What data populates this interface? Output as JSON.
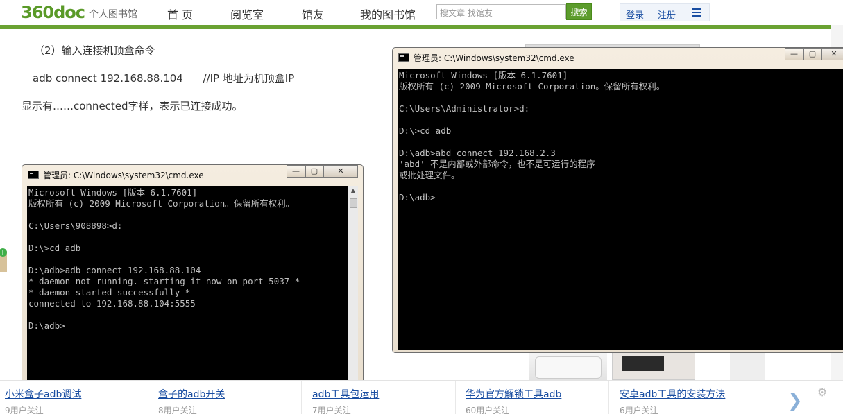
{
  "header": {
    "logo": "360doc",
    "logo_sub": "个人图书馆",
    "nav": [
      "首 页",
      "阅览室",
      "馆友",
      "我的图书馆"
    ],
    "search_placeholder": "搜文章 找馆友",
    "search_button": "搜索",
    "login": "登录",
    "register": "注册",
    "brand_color": "#6aa232"
  },
  "article": {
    "step": "（2）输入连接机顶盒命令",
    "command": "adb connect 192.168.88.104      //IP 地址为机顶盒IP",
    "result": "显示有……connected字样，表示已连接成功。"
  },
  "cmd_left": {
    "title": "管理员: C:\\Windows\\system32\\cmd.exe",
    "lines": [
      "Microsoft Windows [版本 6.1.7601]",
      "版权所有 (c) 2009 Microsoft Corporation。保留所有权利。",
      "",
      "C:\\Users\\908898>d:",
      "",
      "D:\\>cd adb",
      "",
      "D:\\adb>adb connect 192.168.88.104",
      "* daemon not running. starting it now on port 5037 *",
      "* daemon started successfully *",
      "connected to 192.168.88.104:5555",
      "",
      "D:\\adb>"
    ]
  },
  "cmd_right": {
    "title": "管理员: C:\\Windows\\system32\\cmd.exe",
    "lines": [
      "Microsoft Windows [版本 6.1.7601]",
      "版权所有 (c) 2009 Microsoft Corporation。保留所有权利。",
      "",
      "C:\\Users\\Administrator>d:",
      "",
      "D:\\>cd adb",
      "",
      "D:\\adb>abd connect 192.168.2.3",
      "'abd' 不是内部或外部命令，也不是可运行的程序",
      "或批处理文件。",
      "",
      "D:\\adb>"
    ]
  },
  "window_controls": {
    "minimize": "—",
    "maximize": "▢",
    "close": "✕"
  },
  "related": [
    {
      "title": "小米盒子adb调试",
      "followers": "9用户关注"
    },
    {
      "title": "盒子的adb开关",
      "followers": "8用户关注"
    },
    {
      "title": "adb工具包运用",
      "followers": "7用户关注"
    },
    {
      "title": "华为官方解锁工具adb",
      "followers": "60用户关注"
    },
    {
      "title": "安卓adb工具的安装方法",
      "followers": "6用户关注"
    }
  ]
}
